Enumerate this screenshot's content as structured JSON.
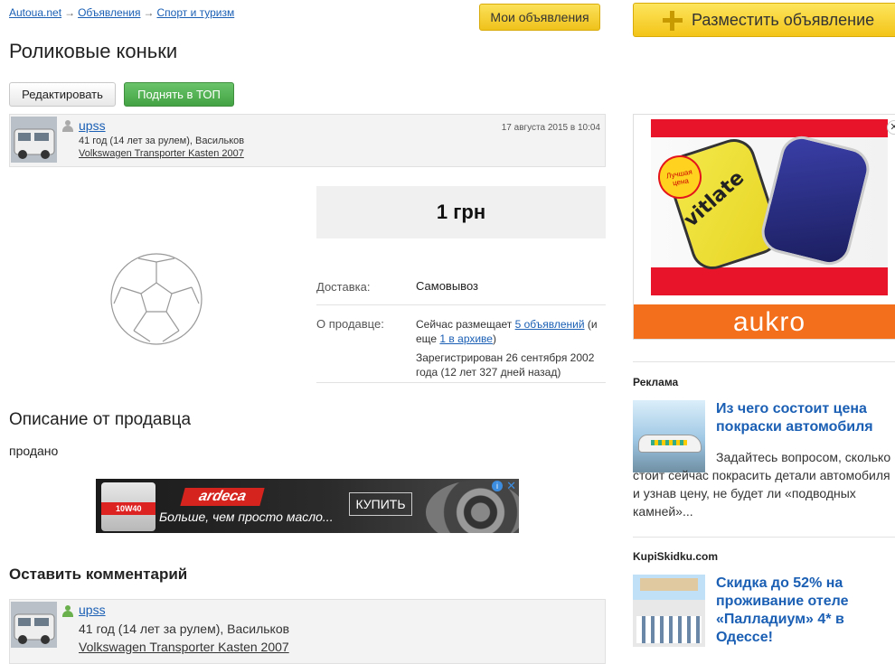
{
  "breadcrumb": {
    "items": [
      "Autoua.net",
      "Объявления",
      "Спорт и туризм"
    ],
    "separator": "→"
  },
  "header": {
    "my_ads_label": "Мои объявления",
    "post_ad_label": "Разместить объявление"
  },
  "page": {
    "title": "Роликовые коньки",
    "edit_label": "Редактировать",
    "raise_label": "Поднять в ТОП"
  },
  "seller": {
    "name": "upss",
    "info": "41 год (14 лет за рулем), Васильков",
    "car": "Volkswagen Transporter Kasten 2007",
    "posted": "17 августа 2015 в 10:04"
  },
  "listing": {
    "price": "1 грн",
    "delivery_label": "Доставка:",
    "delivery_value": "Самовывоз",
    "about_label": "О продавце:",
    "about_pre": "Сейчас размещает ",
    "about_link1": "5 объявлений",
    "about_mid": " (и еще ",
    "about_link2": "1 в архиве",
    "about_post": ")",
    "registered": "Зарегистрирован 26 сентября 2002 года (12 лет 327 дней назад)"
  },
  "description": {
    "heading": "Описание от продавца",
    "text": "продано"
  },
  "banner_ad": {
    "brand": "ardeca",
    "slogan": "Больше, чем просто масло...",
    "buy_label": "КУПИТЬ",
    "product_label": "10W40"
  },
  "comments": {
    "heading": "Оставить комментарий"
  },
  "sidebar_ad": {
    "badge": "Лучшая цена",
    "brand_text": "vitlate",
    "bottom_brand": "aukro",
    "close": "✕"
  },
  "sidebar": {
    "section1_heading": "Реклама",
    "section1_title": "Из чего состоит цена покраски автомобиля",
    "section1_text": "Задайтесь вопросом, сколько стоит сейчас покрасить детали автомобиля и узнав цену, не будет ли «подводных камней»...",
    "section2_heading": "KupiSkidku.com",
    "section2_title": "Скидка до 52% на проживание отеле «Палладиум» 4* в Одессе!"
  },
  "colors": {
    "link": "#1a5fb4",
    "yellow_button": "#f0c21b",
    "green_button": "#43a243",
    "aukro_orange": "#f36f1c"
  }
}
